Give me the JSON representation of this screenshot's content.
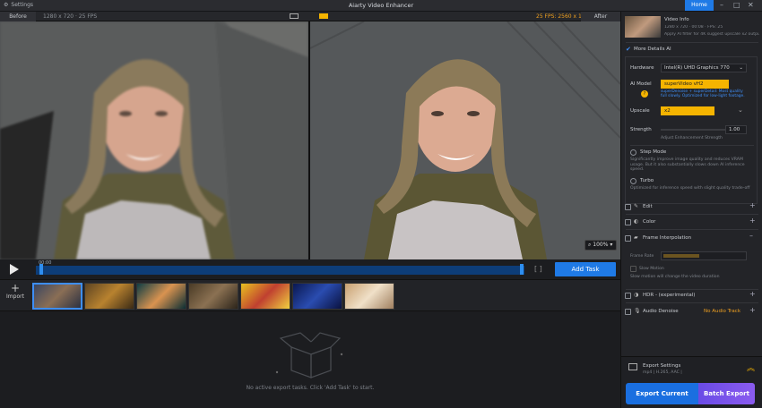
{
  "app": {
    "title": "Aiarty Video Enhancer",
    "settings_label": "Settings",
    "home_label": "Home"
  },
  "viewer": {
    "before_label": "Before",
    "after_label": "After",
    "before_info": "1280 x 720 · 25 FPS",
    "after_info": "25 FPS: 2560 x 1440",
    "zoom": "100%"
  },
  "timeline": {
    "time": "00:00",
    "add_task_label": "Add Task"
  },
  "import_label": "Import",
  "thumbnails": [
    "clip-1",
    "clip-2",
    "clip-3",
    "clip-4",
    "clip-5",
    "clip-6",
    "clip-7"
  ],
  "empty_message": "No active export tasks. Click 'Add Task' to start.",
  "panel": {
    "video_info_title": "Video Info",
    "video_info_line1": "1280 x 720 · 00:08 · FPS: 25",
    "video_info_line2": "Apply AI filter for 4K suggest upscale x2 output",
    "more_details_label": "More Details AI",
    "hardware_label": "Hardware",
    "hardware_value": "Intel(R) UHD Graphics 770",
    "ai_model_label": "AI Model",
    "ai_model_value": "superVideo vH2",
    "ai_model_desc": "superDenoise + superDetail: Most quality full slowly. Optimized for low-light footage.",
    "upscale_label": "Upscale",
    "upscale_value": "x2",
    "strength_label": "Strength",
    "strength_value": "1.00",
    "strength_desc": "Adjust Enhancement Strength",
    "step_mode_label": "Step Mode",
    "step_mode_desc": "Significantly improve image quality and reduces VRAM usage. But it also substantially slows down AI inference speed.",
    "turbo_label": "Turbo",
    "turbo_desc": "Optimized for inference speed with slight quality trade-off",
    "edit_label": "Edit",
    "color_label": "Color",
    "frame_interp_label": "Frame Interpolation",
    "frame_rate_label": "Frame Rate",
    "slow_motion_label": "Slow Motion",
    "slow_motion_desc": "Slow motion will change the video duration",
    "hdr_label": "HDR - (experimental)",
    "audio_denoise_label": "Audio Denoise",
    "audio_denoise_status": "No Audio Track",
    "export_settings_label": "Export Settings",
    "export_settings_value": "mp4 | H.265, AAC |",
    "export_current_label": "Export Current",
    "batch_export_label": "Batch Export"
  },
  "colors": {
    "accent": "#1f7ae6",
    "ai_yellow": "#f5b400",
    "batch_purple": "#7a52ea",
    "no_audio": "#f0a020"
  }
}
